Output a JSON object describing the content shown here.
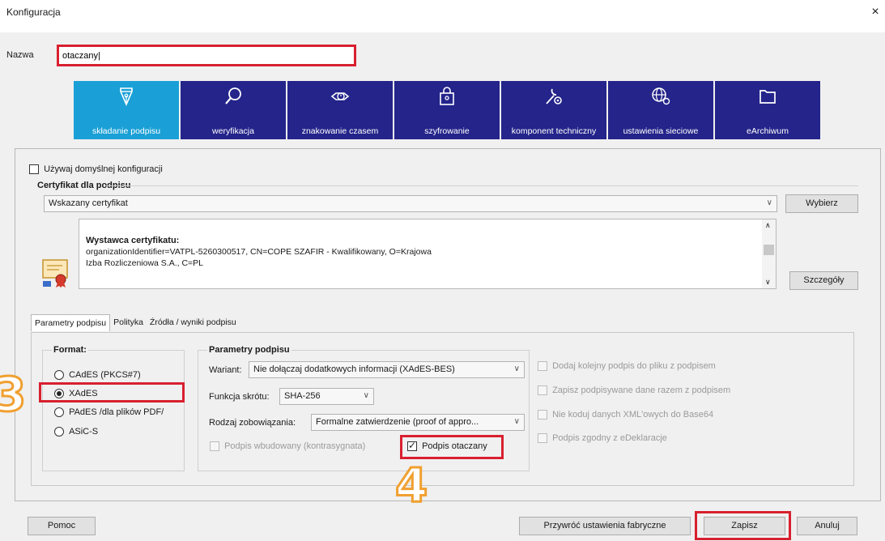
{
  "window": {
    "title": "Konfiguracja",
    "close_symbol": "×"
  },
  "name_field": {
    "label": "Nazwa",
    "value": "otaczany|"
  },
  "nav_tiles": [
    {
      "label": "składanie podpisu",
      "icon": "pen-nib-icon"
    },
    {
      "label": "weryfikacja",
      "icon": "magnifier-icon"
    },
    {
      "label": "znakowanie czasem",
      "icon": "stamp-clock-icon"
    },
    {
      "label": "szyfrowanie",
      "icon": "padlock-icon"
    },
    {
      "label": "komponent techniczny",
      "icon": "wrench-gear-icon"
    },
    {
      "label": "ustawienia sieciowe",
      "icon": "globe-gear-icon"
    },
    {
      "label": "eArchiwum",
      "icon": "folder-icon"
    }
  ],
  "default_config_checkbox": {
    "label": "Używaj domyślnej konfiguracji",
    "checked": false
  },
  "certificate": {
    "section_title": "Certyfikat dla podpisu",
    "select_value": "Wskazany certyfikat",
    "choose_button": "Wybierz",
    "issuer_label": "Wystawca certyfikatu:",
    "issuer_line1": "organizationIdentifier=VATPL-5260300517, CN=COPE SZAFIR - Kwalifikowany, O=Krajowa",
    "issuer_line2": "Izba Rozliczeniowa S.A., C=PL",
    "details_button": "Szczegóły"
  },
  "subtabs": [
    "Parametry podpisu",
    "Polityka",
    "Źródła / wyniki podpisu"
  ],
  "format": {
    "title": "Format:",
    "options": [
      {
        "label": "CAdES (PKCS#7)",
        "selected": false
      },
      {
        "label": "XAdES",
        "selected": true
      },
      {
        "label": "PAdES /dla plików PDF/",
        "selected": false
      },
      {
        "label": "ASiC-S",
        "selected": false
      }
    ]
  },
  "signature_params": {
    "title": "Parametry podpisu",
    "variant_label": "Wariant:",
    "variant_value": "Nie dołączaj dodatkowych informacji (XAdES-BES)",
    "hash_label": "Funkcja skrótu:",
    "hash_value": "SHA-256",
    "commitment_label": "Rodzaj zobowiązania:",
    "commitment_value": "Formalne zatwierdzenie (proof of appro...",
    "countersign_label": "Podpis wbudowany (kontrasygnata)",
    "enveloping_label": "Podpis otaczany",
    "enveloping_checked": true
  },
  "right_options": [
    "Dodaj kolejny podpis do pliku z podpisem",
    "Zapisz podpisywane dane razem z podpisem",
    "Nie koduj danych XML'owych do Base64",
    "Podpis zgodny z eDeklaracje"
  ],
  "footer": {
    "help_button": "Pomoc",
    "reset_button": "Przywróć ustawienia fabryczne",
    "save_button": "Zapisz",
    "cancel_button": "Anuluj"
  },
  "step_markers": [
    "3",
    "4"
  ],
  "colors": {
    "tile_bg": "#24248b",
    "tile_active": "#1aa0d6",
    "highlight": "#d8202f",
    "marker": "#f0a030"
  }
}
